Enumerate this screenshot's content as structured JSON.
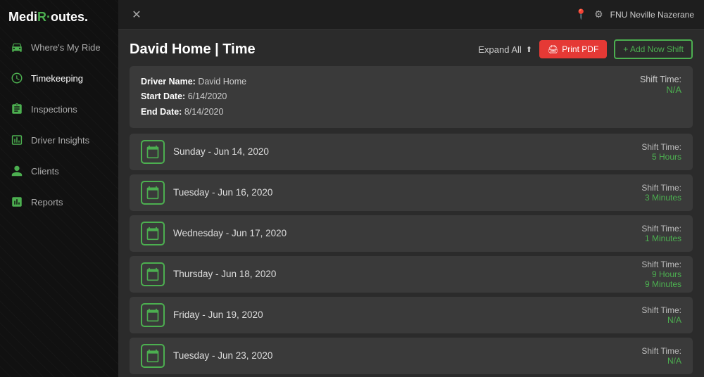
{
  "app": {
    "logo_main": "MediR",
    "logo_accent": "outes",
    "logo_dot": "·"
  },
  "topbar": {
    "close_label": "✕",
    "user_name": "FNU Neville Nazerane"
  },
  "sidebar": {
    "items": [
      {
        "id": "where-my-ride",
        "label": "Where's My Ride",
        "icon": "car"
      },
      {
        "id": "timekeeping",
        "label": "Timekeeping",
        "icon": "clock",
        "active": true
      },
      {
        "id": "inspections",
        "label": "Inspections",
        "icon": "clipboard"
      },
      {
        "id": "driver-insights",
        "label": "Driver Insights",
        "icon": "chart"
      },
      {
        "id": "clients",
        "label": "Clients",
        "icon": "person"
      },
      {
        "id": "reports",
        "label": "Reports",
        "icon": "bar-chart"
      }
    ]
  },
  "page": {
    "title": "David Home | Time",
    "expand_all_label": "Expand All"
  },
  "buttons": {
    "print_pdf": "Print PDF",
    "add_shift": "+ Add Now Shift"
  },
  "summary": {
    "driver_name_label": "Driver Name:",
    "driver_name_value": "David Home",
    "start_date_label": "Start Date:",
    "start_date_value": "6/14/2020",
    "end_date_label": "End Date:",
    "end_date_value": "8/14/2020",
    "shift_time_label": "Shift Time:",
    "shift_time_value": "N/A"
  },
  "shifts": [
    {
      "date": "Sunday - Jun 14, 2020",
      "shift_time_label": "Shift Time:",
      "shift_time_value": "5 Hours"
    },
    {
      "date": "Tuesday - Jun 16, 2020",
      "shift_time_label": "Shift Time:",
      "shift_time_value": "3 Minutes"
    },
    {
      "date": "Wednesday - Jun 17, 2020",
      "shift_time_label": "Shift Time:",
      "shift_time_value": "1 Minutes"
    },
    {
      "date": "Thursday - Jun 18, 2020",
      "shift_time_label": "Shift Time:",
      "shift_time_values": [
        "9 Hours",
        "9 Minutes"
      ]
    },
    {
      "date": "Friday - Jun 19, 2020",
      "shift_time_label": "Shift Time:",
      "shift_time_value": "N/A"
    },
    {
      "date": "Tuesday - Jun 23, 2020",
      "shift_time_label": "Shift Time:",
      "shift_time_value": "N/A"
    }
  ]
}
